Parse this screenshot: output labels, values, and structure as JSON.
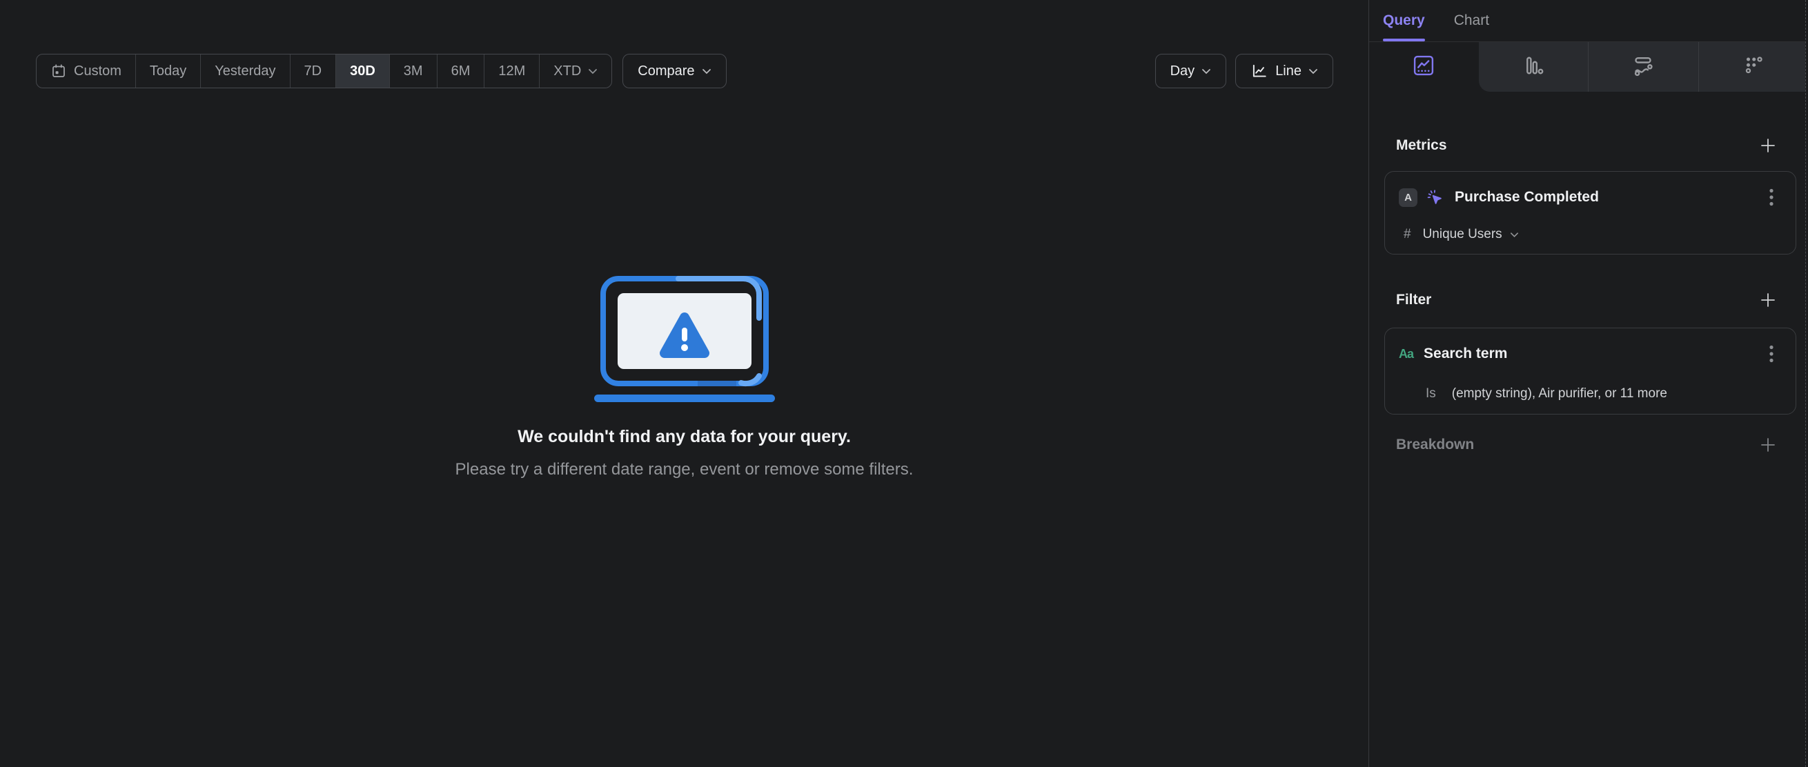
{
  "toolbar": {
    "date_ranges": [
      {
        "label": "Custom"
      },
      {
        "label": "Today"
      },
      {
        "label": "Yesterday"
      },
      {
        "label": "7D"
      },
      {
        "label": "30D"
      },
      {
        "label": "3M"
      },
      {
        "label": "6M"
      },
      {
        "label": "12M"
      },
      {
        "label": "XTD"
      }
    ],
    "selected_range": "30D",
    "compare_label": "Compare",
    "granularity_label": "Day",
    "chart_type_label": "Line"
  },
  "empty_state": {
    "title": "We couldn't find any data for your query.",
    "subtitle": "Please try a different date range, event or remove some filters."
  },
  "sidebar": {
    "tabs": [
      {
        "label": "Query"
      },
      {
        "label": "Chart"
      }
    ],
    "active_tab": "Query",
    "icon_tabs": [
      "insights-line-chart",
      "funnels-bars",
      "flows-squiggle",
      "retention-dots"
    ],
    "metrics": {
      "heading": "Metrics",
      "add_icon": "plus-icon",
      "items": [
        {
          "series_letter": "A",
          "event_icon": "event-cursor-icon",
          "event_name": "Purchase Completed",
          "aggregation_symbol": "#",
          "aggregation_label": "Unique Users"
        }
      ]
    },
    "filter": {
      "heading": "Filter",
      "add_icon": "plus-icon",
      "items": [
        {
          "type_label": "Aa",
          "property_name": "Search term",
          "operator": "Is",
          "values_summary": "(empty string), Air purifier, or 11 more"
        }
      ]
    },
    "breakdown": {
      "heading": "Breakdown",
      "add_icon": "plus-icon"
    }
  },
  "colors": {
    "accent_purple": "#8177f0",
    "accent_green": "#43a580",
    "accent_blue": "#3181e2",
    "selected_segment_bg": "#313439"
  }
}
